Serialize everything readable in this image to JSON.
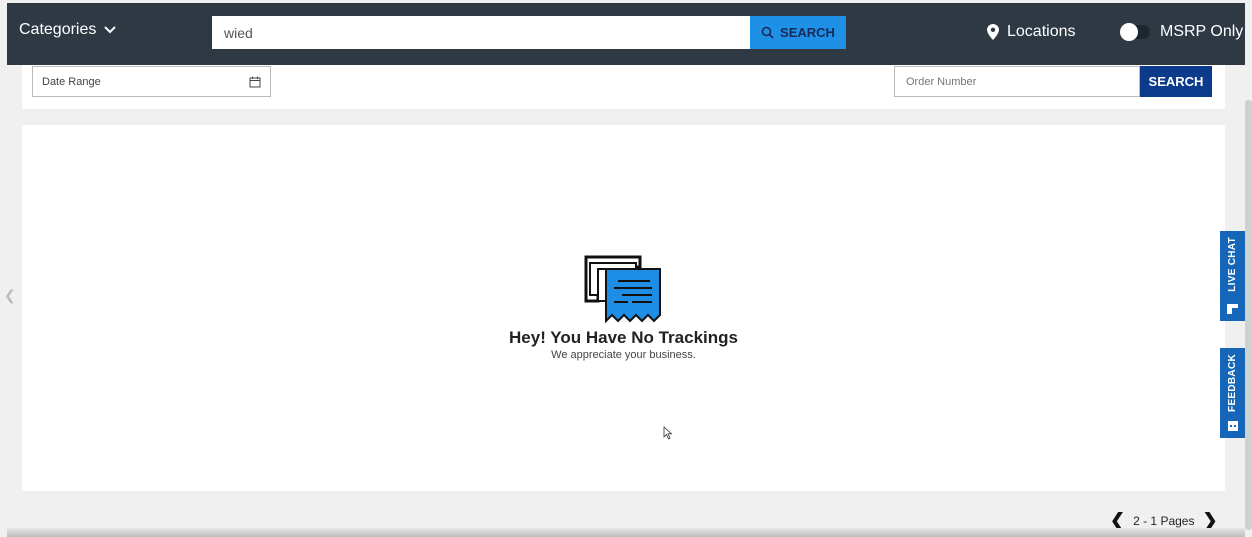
{
  "header": {
    "categories_label": "Categories",
    "search_value": "wied",
    "search_button_label": "SEARCH",
    "locations_label": "Locations",
    "msrp_label": "MSRP Only"
  },
  "filters": {
    "date_range_placeholder": "Date Range",
    "order_number_placeholder": "Order Number",
    "search_button_label": "SEARCH"
  },
  "empty_state": {
    "title": "Hey! You Have No Trackings",
    "subtitle": "We appreciate your business."
  },
  "pagination": {
    "label": "2 - 1 Pages"
  },
  "side_tabs": {
    "live_chat": "LIVE CHAT",
    "feedback": "FEEDBACK"
  },
  "colors": {
    "header_bg": "#2e3944",
    "search_button": "#1e90e6",
    "order_search_button": "#0d3b8c",
    "side_tab": "#1566b8"
  }
}
